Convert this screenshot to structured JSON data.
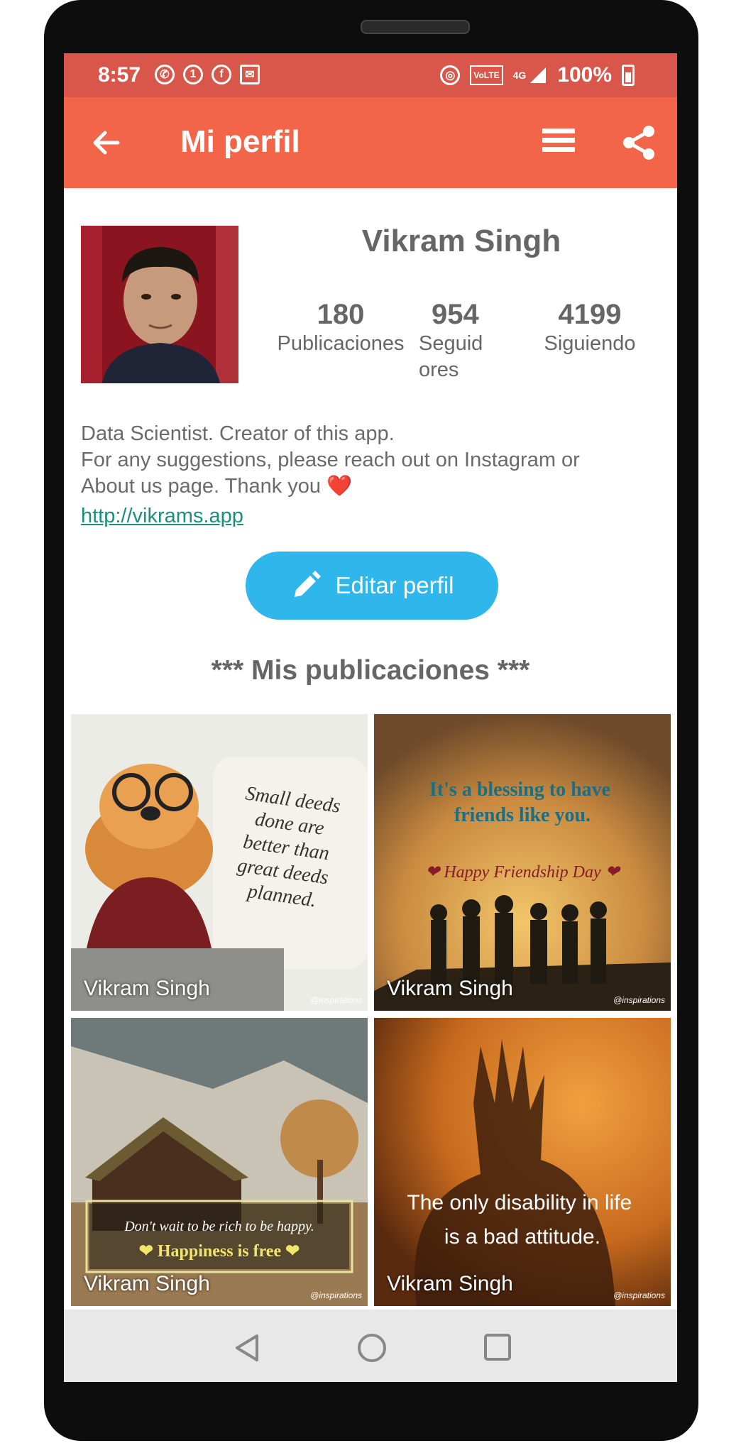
{
  "status_bar": {
    "time": "8:57",
    "battery": "100%",
    "volte_label": "VoLTE",
    "network_label": "4G"
  },
  "toolbar": {
    "title": "Mi perfil"
  },
  "profile": {
    "name": "Vikram Singh",
    "stats": [
      {
        "value": "180",
        "label": "Publicaciones"
      },
      {
        "value": "954",
        "label_line1": "Seguid",
        "label_line2": "ores"
      },
      {
        "value": "4199",
        "label": "Siguiendo"
      }
    ],
    "bio_lines": [
      "Data Scientist. Creator of this app.",
      "For any suggestions, please reach out on Instagram or",
      "About us page. Thank you"
    ],
    "bio_emoji": "❤️",
    "link": "http://vikrams.app",
    "edit_button": "Editar perfil"
  },
  "posts_section": {
    "title": "*** Mis publicaciones ***",
    "posts": [
      {
        "author": "Vikram Singh",
        "quote_lines": [
          "Small deeds",
          "done are",
          "better than",
          "great deeds",
          "planned."
        ],
        "credit": "@inspirations"
      },
      {
        "author": "Vikram Singh",
        "quote_lines": [
          "It's a blessing to have",
          "friends like you."
        ],
        "subtitle": "Happy Friendship Day",
        "credit": "@inspirations"
      },
      {
        "author": "Vikram Singh",
        "quote_lines": [
          "Don't wait to be rich to be happy."
        ],
        "subtitle": "Happiness is free",
        "credit": "@inspirations"
      },
      {
        "author": "Vikram Singh",
        "quote_lines": [
          "The only disability in life",
          "is a bad attitude."
        ],
        "credit": "@inspirations"
      }
    ]
  },
  "colors": {
    "status_bar": "#d9574a",
    "toolbar": "#f26549",
    "edit_button": "#2fb6ea",
    "link": "#1a8f7e"
  }
}
